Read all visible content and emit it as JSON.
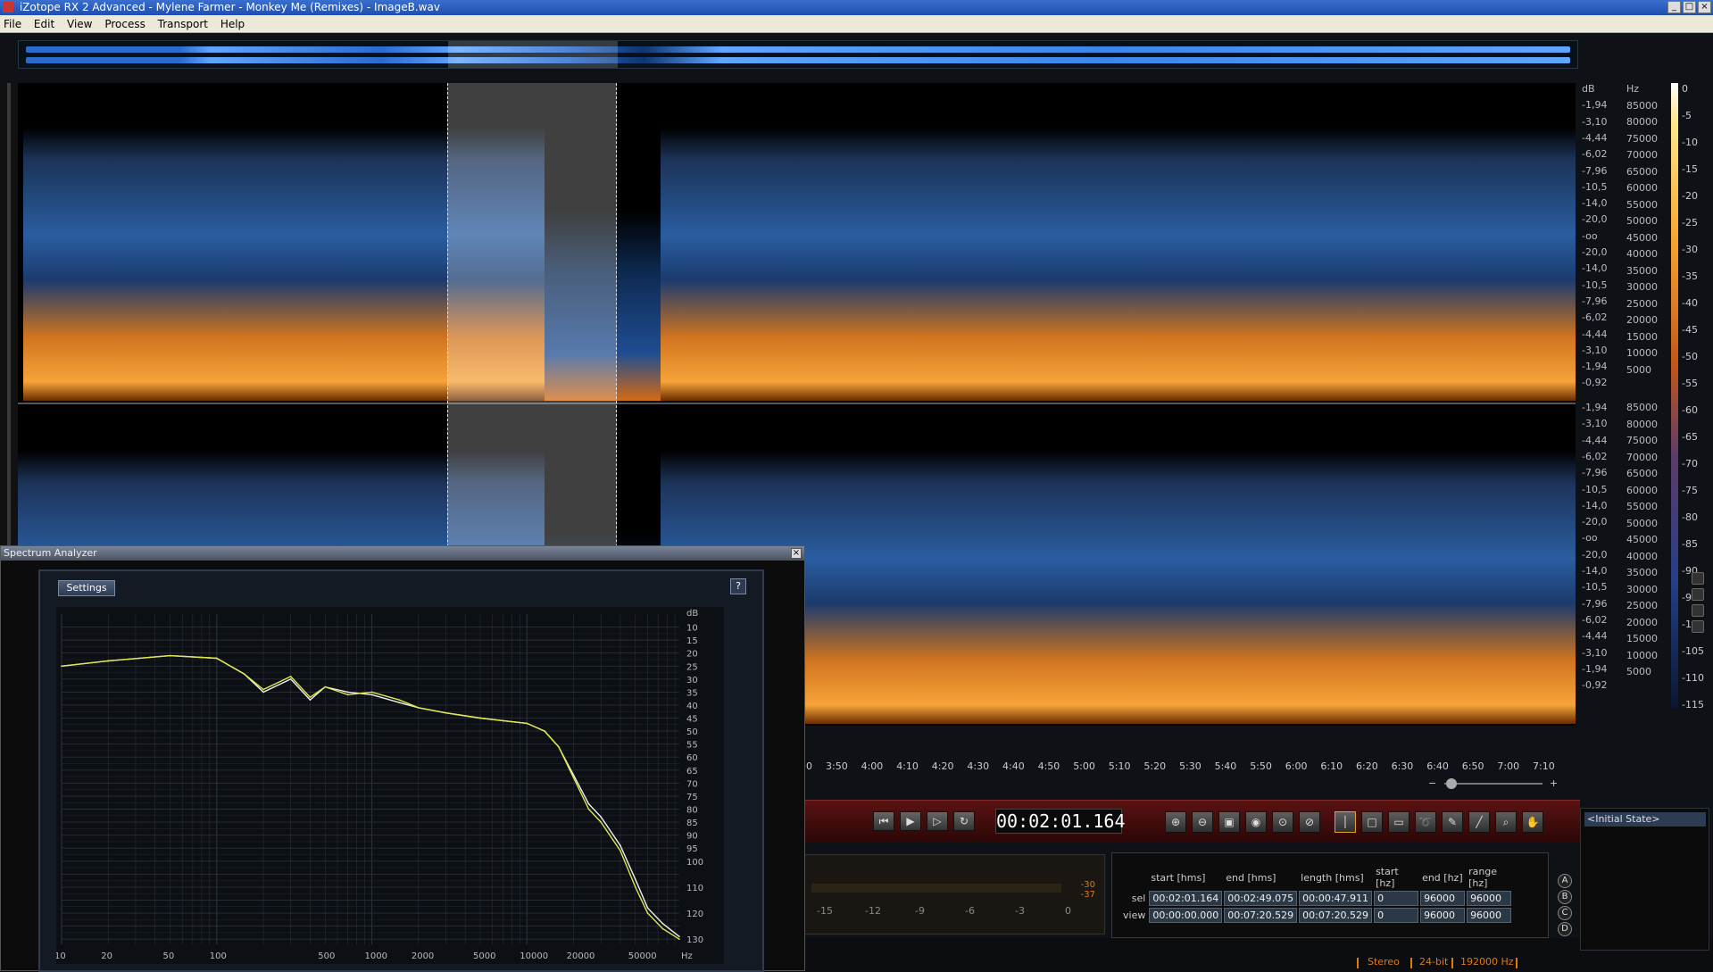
{
  "window": {
    "title": "iZotope RX 2 Advanced - Mylene Farmer - Monkey Me (Remixes) - ImageB.wav"
  },
  "menu": [
    "File",
    "Edit",
    "View",
    "Process",
    "Transport",
    "Help"
  ],
  "spectrogram": {
    "db_labels": [
      "dB",
      "-1,94",
      "-3,10",
      "-4,44",
      "-6,02",
      "-7,96",
      "-10,5",
      "-14,0",
      "-20,0",
      "-oo",
      "-20,0",
      "-14,0",
      "-10,5",
      "-7,96",
      "-6,02",
      "-4,44",
      "-3,10",
      "-1,94",
      "-0,92"
    ],
    "db_labels_ch2": [
      "-1,94",
      "-3,10",
      "-4,44",
      "-6,02",
      "-7,96",
      "-10,5",
      "-14,0",
      "-20,0",
      "-oo",
      "-20,0",
      "-14,0",
      "-10,5",
      "-7,96",
      "-6,02",
      "-4,44",
      "-3,10",
      "-1,94",
      "-0,92"
    ],
    "hz_labels": [
      "Hz",
      "85000",
      "80000",
      "75000",
      "70000",
      "65000",
      "60000",
      "55000",
      "50000",
      "45000",
      "40000",
      "35000",
      "30000",
      "25000",
      "20000",
      "15000",
      "10000",
      "5000"
    ],
    "hz_labels_ch2": [
      "85000",
      "80000",
      "75000",
      "70000",
      "65000",
      "60000",
      "55000",
      "50000",
      "45000",
      "40000",
      "35000",
      "30000",
      "25000",
      "20000",
      "15000",
      "10000",
      "5000"
    ],
    "color_scale": [
      "0",
      "-5",
      "-10",
      "-15",
      "-20",
      "-25",
      "-30",
      "-35",
      "-40",
      "-45",
      "-50",
      "-55",
      "-60",
      "-65",
      "-70",
      "-75",
      "-80",
      "-85",
      "-90",
      "-95",
      "-100",
      "-105",
      "-110",
      "-115"
    ],
    "time_axis": [
      "0",
      "3:50",
      "4:00",
      "4:10",
      "4:20",
      "4:30",
      "4:40",
      "4:50",
      "5:00",
      "5:10",
      "5:20",
      "5:30",
      "5:40",
      "5:50",
      "6:00",
      "6:10",
      "6:20",
      "6:30",
      "6:40",
      "6:50",
      "7:00",
      "7:10"
    ]
  },
  "transport": {
    "time_display": "00:02:01.164",
    "buttons": [
      "to-start",
      "play",
      "play-selection",
      "loop"
    ]
  },
  "meter": {
    "labels": [
      "-15",
      "-12",
      "-9",
      "-6",
      "-3",
      "0"
    ],
    "peak_top": "-30",
    "peak_bottom": "-37"
  },
  "selection": {
    "headers": [
      "start [hms]",
      "end [hms]",
      "length [hms]",
      "start [hz]",
      "end [hz]",
      "range [hz]"
    ],
    "rows": [
      {
        "label": "sel",
        "start": "00:02:01.164",
        "end": "00:02:49.075",
        "length": "00:00:47.911",
        "start_hz": "0",
        "end_hz": "96000",
        "range_hz": "96000"
      },
      {
        "label": "view",
        "start": "00:00:00.000",
        "end": "00:07:20.529",
        "length": "00:07:20.529",
        "start_hz": "0",
        "end_hz": "96000",
        "range_hz": "96000"
      }
    ]
  },
  "ab_buttons": [
    "A",
    "B",
    "C",
    "D"
  ],
  "history": {
    "items": [
      "<Initial State>"
    ]
  },
  "status": {
    "channels": "Stereo",
    "bit_depth": "24-bit",
    "sample_rate": "192000 Hz"
  },
  "analyzer": {
    "title": "Spectrum Analyzer",
    "settings_label": "Settings",
    "help_label": "?",
    "y_labels": [
      "dB",
      "10",
      "15",
      "20",
      "25",
      "30",
      "35",
      "40",
      "45",
      "50",
      "55",
      "60",
      "65",
      "70",
      "75",
      "80",
      "85",
      "90",
      "95",
      "100",
      "110",
      "120",
      "130"
    ],
    "x_labels": [
      "10",
      "20",
      "50",
      "100",
      "500",
      "1000",
      "2000",
      "5000",
      "10000",
      "20000",
      "50000",
      "Hz"
    ],
    "colors": {
      "curve_a": "#dfe84a",
      "curve_b": "#f0f0f0",
      "grid": "#2a2f36"
    }
  },
  "chart_data": {
    "type": "line",
    "title": "",
    "xlabel": "Hz",
    "ylabel": "dB",
    "x_scale": "log",
    "xlim": [
      10,
      96000
    ],
    "ylim": [
      5,
      132
    ],
    "grid": true,
    "series": [
      {
        "x": [
          10,
          20,
          50,
          100,
          150,
          200,
          300,
          400,
          500,
          700,
          1000,
          1500,
          2000,
          3000,
          5000,
          7000,
          10000,
          13000,
          16000,
          20000,
          25000,
          30000,
          40000,
          50000,
          60000,
          75000,
          96000
        ],
        "y": [
          25,
          23,
          21,
          22,
          28,
          34,
          29,
          37,
          33,
          36,
          35,
          38,
          41,
          43,
          45,
          46,
          47,
          50,
          56,
          68,
          80,
          85,
          96,
          110,
          120,
          126,
          130
        ]
      },
      {
        "x": [
          10,
          20,
          50,
          100,
          150,
          200,
          300,
          400,
          500,
          700,
          1000,
          1500,
          2000,
          3000,
          5000,
          7000,
          10000,
          13000,
          16000,
          20000,
          25000,
          30000,
          40000,
          50000,
          60000,
          75000,
          96000
        ],
        "y": [
          25,
          23,
          21,
          22,
          28,
          35,
          30,
          38,
          33,
          35,
          36,
          39,
          41,
          43,
          45,
          46,
          47,
          50,
          56,
          67,
          78,
          83,
          94,
          107,
          118,
          124,
          129
        ]
      }
    ]
  }
}
